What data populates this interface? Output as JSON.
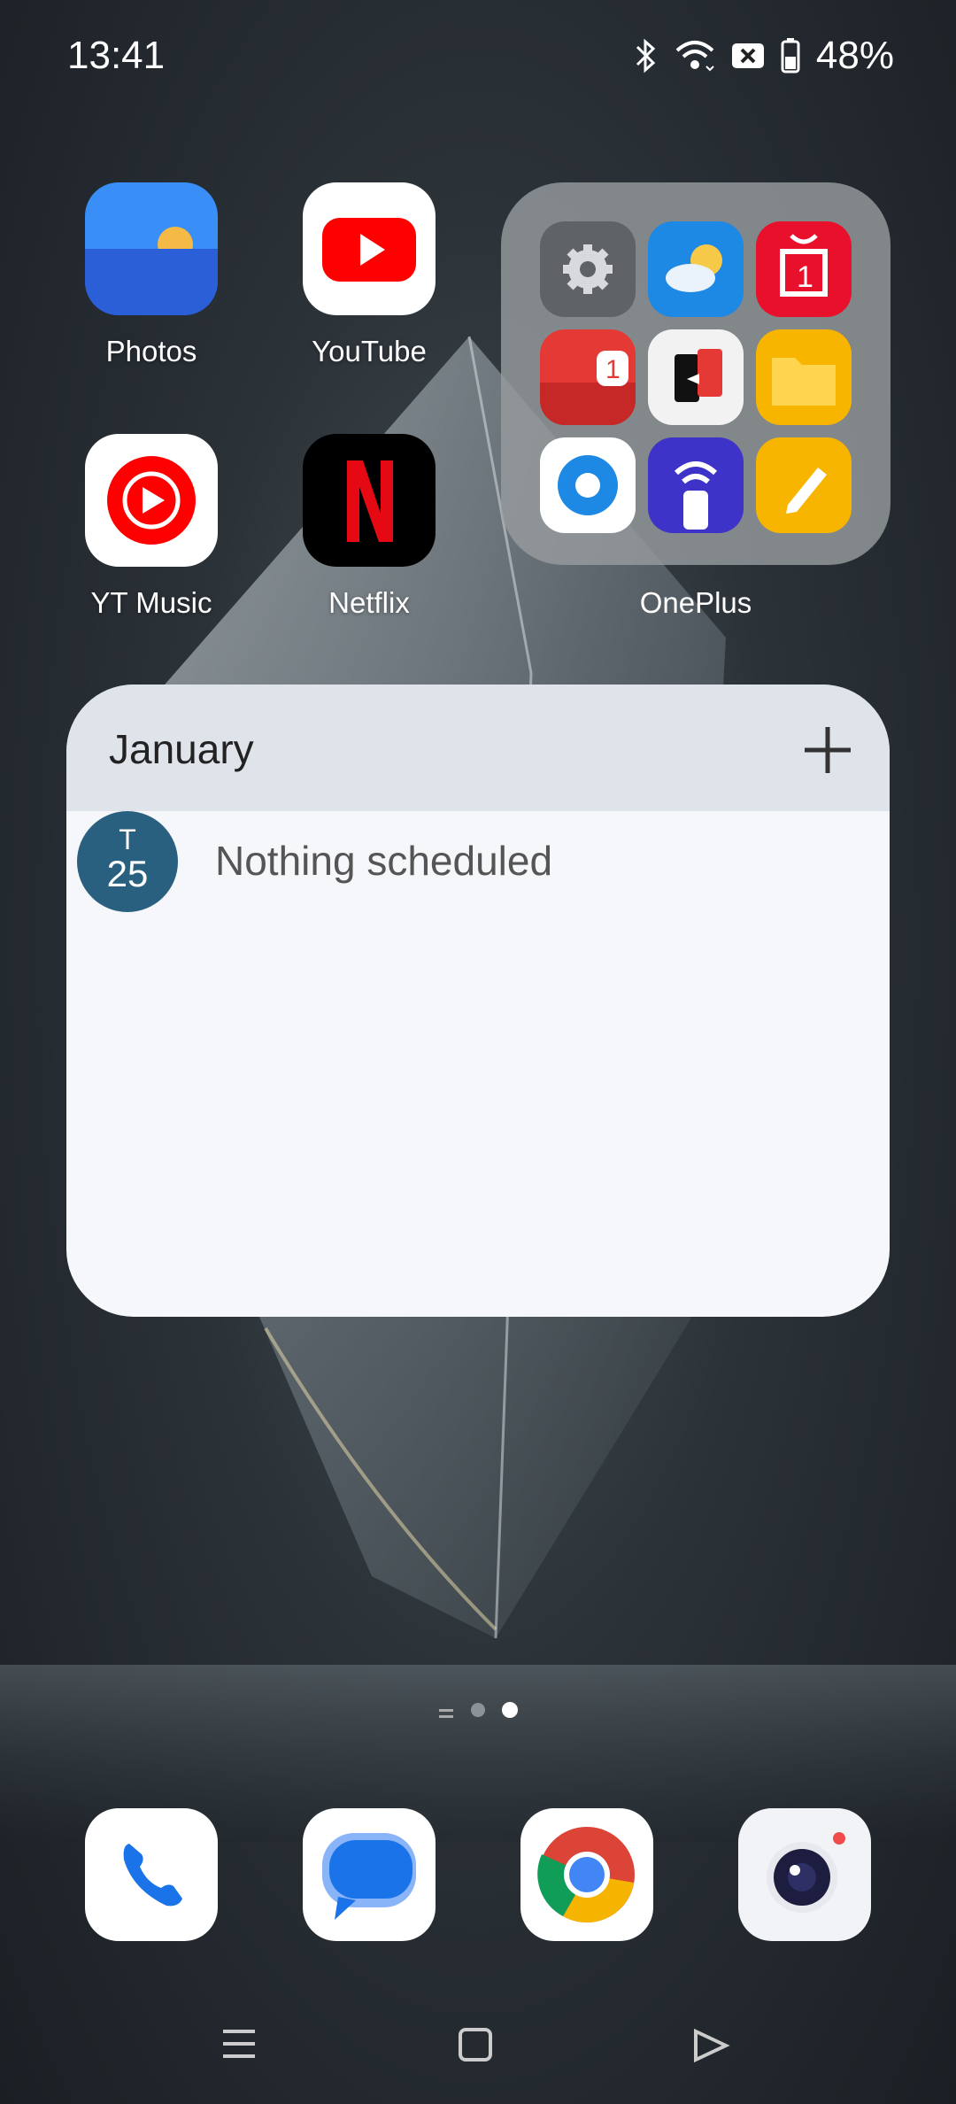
{
  "status_bar": {
    "time": "13:41",
    "battery": "48%"
  },
  "apps": {
    "photos": "Photos",
    "youtube": "YouTube",
    "yt_music": "YT Music",
    "netflix": "Netflix"
  },
  "folder": {
    "label": "OnePlus",
    "badge": "1"
  },
  "calendar_widget": {
    "month": "January",
    "day_letter": "T",
    "day_number": "25",
    "empty_text": "Nothing scheduled"
  },
  "dock": [
    "phone-icon",
    "messages-icon",
    "chrome-icon",
    "camera-icon"
  ],
  "page_indicator": {
    "pages": 2,
    "current": 2
  },
  "colors": {
    "widget_badge": "#2a607f",
    "youtube_red": "#ff0000",
    "netflix_red": "#e50914"
  }
}
